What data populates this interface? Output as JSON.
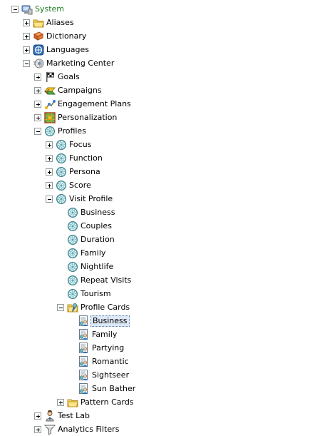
{
  "colors": {
    "system_label": "#1f7a1f",
    "selection_background": "#dde8f6",
    "selection_border": "#5a7fb0"
  },
  "tree": [
    {
      "label": "System",
      "depth": 0,
      "toggle": "minus",
      "icon": "system-computer-icon",
      "style": "green"
    },
    {
      "label": "Aliases",
      "depth": 1,
      "toggle": "plus",
      "icon": "folder-icon"
    },
    {
      "label": "Dictionary",
      "depth": 1,
      "toggle": "plus",
      "icon": "dictionary-book-icon"
    },
    {
      "label": "Languages",
      "depth": 1,
      "toggle": "plus",
      "icon": "languages-globe-icon"
    },
    {
      "label": "Marketing Center",
      "depth": 1,
      "toggle": "minus",
      "icon": "marketing-center-icon"
    },
    {
      "label": "Goals",
      "depth": 2,
      "toggle": "plus",
      "icon": "goals-flag-icon"
    },
    {
      "label": "Campaigns",
      "depth": 2,
      "toggle": "plus",
      "icon": "campaigns-icon"
    },
    {
      "label": "Engagement Plans",
      "depth": 2,
      "toggle": "plus",
      "icon": "engagement-plans-icon"
    },
    {
      "label": "Personalization",
      "depth": 2,
      "toggle": "plus",
      "icon": "personalization-grid-icon"
    },
    {
      "label": "Profiles",
      "depth": 2,
      "toggle": "minus",
      "icon": "profile-gear-icon"
    },
    {
      "label": "Focus",
      "depth": 3,
      "toggle": "plus",
      "icon": "profile-gear-icon"
    },
    {
      "label": "Function",
      "depth": 3,
      "toggle": "plus",
      "icon": "profile-gear-icon"
    },
    {
      "label": "Persona",
      "depth": 3,
      "toggle": "plus",
      "icon": "profile-gear-icon"
    },
    {
      "label": "Score",
      "depth": 3,
      "toggle": "plus",
      "icon": "profile-gear-icon"
    },
    {
      "label": "Visit Profile",
      "depth": 3,
      "toggle": "minus",
      "icon": "profile-gear-icon"
    },
    {
      "label": "Business",
      "depth": 4,
      "toggle": "none",
      "icon": "profile-gear-icon"
    },
    {
      "label": "Couples",
      "depth": 4,
      "toggle": "none",
      "icon": "profile-gear-icon"
    },
    {
      "label": "Duration",
      "depth": 4,
      "toggle": "none",
      "icon": "profile-gear-icon"
    },
    {
      "label": "Family",
      "depth": 4,
      "toggle": "none",
      "icon": "profile-gear-icon"
    },
    {
      "label": "Nightlife",
      "depth": 4,
      "toggle": "none",
      "icon": "profile-gear-icon"
    },
    {
      "label": "Repeat Visits",
      "depth": 4,
      "toggle": "none",
      "icon": "profile-gear-icon"
    },
    {
      "label": "Tourism",
      "depth": 4,
      "toggle": "none",
      "icon": "profile-gear-icon"
    },
    {
      "label": "Profile Cards",
      "depth": 4,
      "toggle": "minus",
      "icon": "profile-cards-folder-icon"
    },
    {
      "label": "Business",
      "depth": 5,
      "toggle": "none",
      "icon": "profile-card-icon",
      "selected": true
    },
    {
      "label": "Family",
      "depth": 5,
      "toggle": "none",
      "icon": "profile-card-icon"
    },
    {
      "label": "Partying",
      "depth": 5,
      "toggle": "none",
      "icon": "profile-card-icon"
    },
    {
      "label": "Romantic",
      "depth": 5,
      "toggle": "none",
      "icon": "profile-card-icon"
    },
    {
      "label": "Sightseer",
      "depth": 5,
      "toggle": "none",
      "icon": "profile-card-icon"
    },
    {
      "label": "Sun Bather",
      "depth": 5,
      "toggle": "none",
      "icon": "profile-card-icon"
    },
    {
      "label": "Pattern Cards",
      "depth": 4,
      "toggle": "plus",
      "icon": "folder-icon"
    },
    {
      "label": "Test Lab",
      "depth": 2,
      "toggle": "plus",
      "icon": "test-lab-person-icon"
    },
    {
      "label": "Analytics Filters",
      "depth": 2,
      "toggle": "plus",
      "icon": "analytics-filter-funnel-icon"
    }
  ]
}
